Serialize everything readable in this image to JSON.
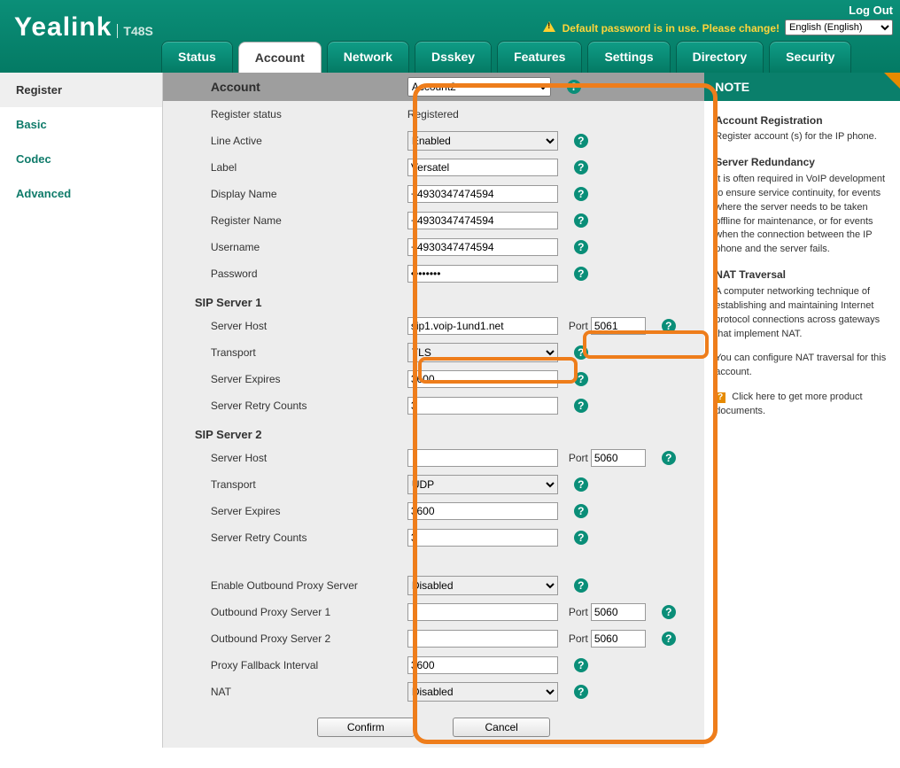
{
  "top": {
    "logout": "Log Out",
    "warning": "Default password is in use. Please change!",
    "language": "English (English)",
    "logo": "Yealink",
    "model": "T48S"
  },
  "tabs": {
    "status": "Status",
    "account": "Account",
    "network": "Network",
    "dsskey": "Dsskey",
    "features": "Features",
    "settings": "Settings",
    "directory": "Directory",
    "security": "Security"
  },
  "side": {
    "register": "Register",
    "basic": "Basic",
    "codec": "Codec",
    "advanced": "Advanced"
  },
  "form": {
    "account_label": "Account",
    "account_value": "Account2",
    "register_status_label": "Register status",
    "register_status_value": "Registered",
    "line_active_label": "Line Active",
    "line_active_value": "Enabled",
    "label_label": "Label",
    "label_value": "Versatel",
    "display_name_label": "Display Name",
    "display_name_value": "+4930347474594",
    "register_name_label": "Register Name",
    "register_name_value": "+4930347474594",
    "username_label": "Username",
    "username_value": "+4930347474594",
    "password_label": "Password",
    "password_value": "••••••••",
    "sip1_head": "SIP Server 1",
    "sip1_host_label": "Server Host",
    "sip1_host_value": "sip1.voip-1und1.net",
    "sip1_port_label": "Port",
    "sip1_port_value": "5061",
    "sip1_transport_label": "Transport",
    "sip1_transport_value": "TLS",
    "sip1_expires_label": "Server Expires",
    "sip1_expires_value": "3600",
    "sip1_retry_label": "Server Retry Counts",
    "sip1_retry_value": "3",
    "sip2_head": "SIP Server 2",
    "sip2_host_label": "Server Host",
    "sip2_host_value": "",
    "sip2_port_label": "Port",
    "sip2_port_value": "5060",
    "sip2_transport_label": "Transport",
    "sip2_transport_value": "UDP",
    "sip2_expires_label": "Server Expires",
    "sip2_expires_value": "3600",
    "sip2_retry_label": "Server Retry Counts",
    "sip2_retry_value": "3",
    "opx_enable_label": "Enable Outbound Proxy Server",
    "opx_enable_value": "Disabled",
    "opx1_label": "Outbound Proxy Server 1",
    "opx1_value": "",
    "opx1_port_label": "Port",
    "opx1_port_value": "5060",
    "opx2_label": "Outbound Proxy Server 2",
    "opx2_value": "",
    "opx2_port_label": "Port",
    "opx2_port_value": "5060",
    "fallback_label": "Proxy Fallback Interval",
    "fallback_value": "3600",
    "nat_label": "NAT",
    "nat_value": "Disabled",
    "confirm": "Confirm",
    "cancel": "Cancel"
  },
  "note": {
    "title": "NOTE",
    "h1": "Account Registration",
    "p1": "Register account (s) for the IP phone.",
    "h2": "Server Redundancy",
    "p2": "It is often required in VoIP development to ensure service continuity, for events where the server needs to be taken offline for maintenance, or for events when the connection between the IP phone and the server fails.",
    "h3": "NAT Traversal",
    "p3": "A computer networking technique of establishing and maintaining Internet protocol connections across gateways that implement NAT.",
    "p4": "You can configure NAT traversal for this account.",
    "doc_icon": "?",
    "doc": " Click here to get more product documents."
  }
}
